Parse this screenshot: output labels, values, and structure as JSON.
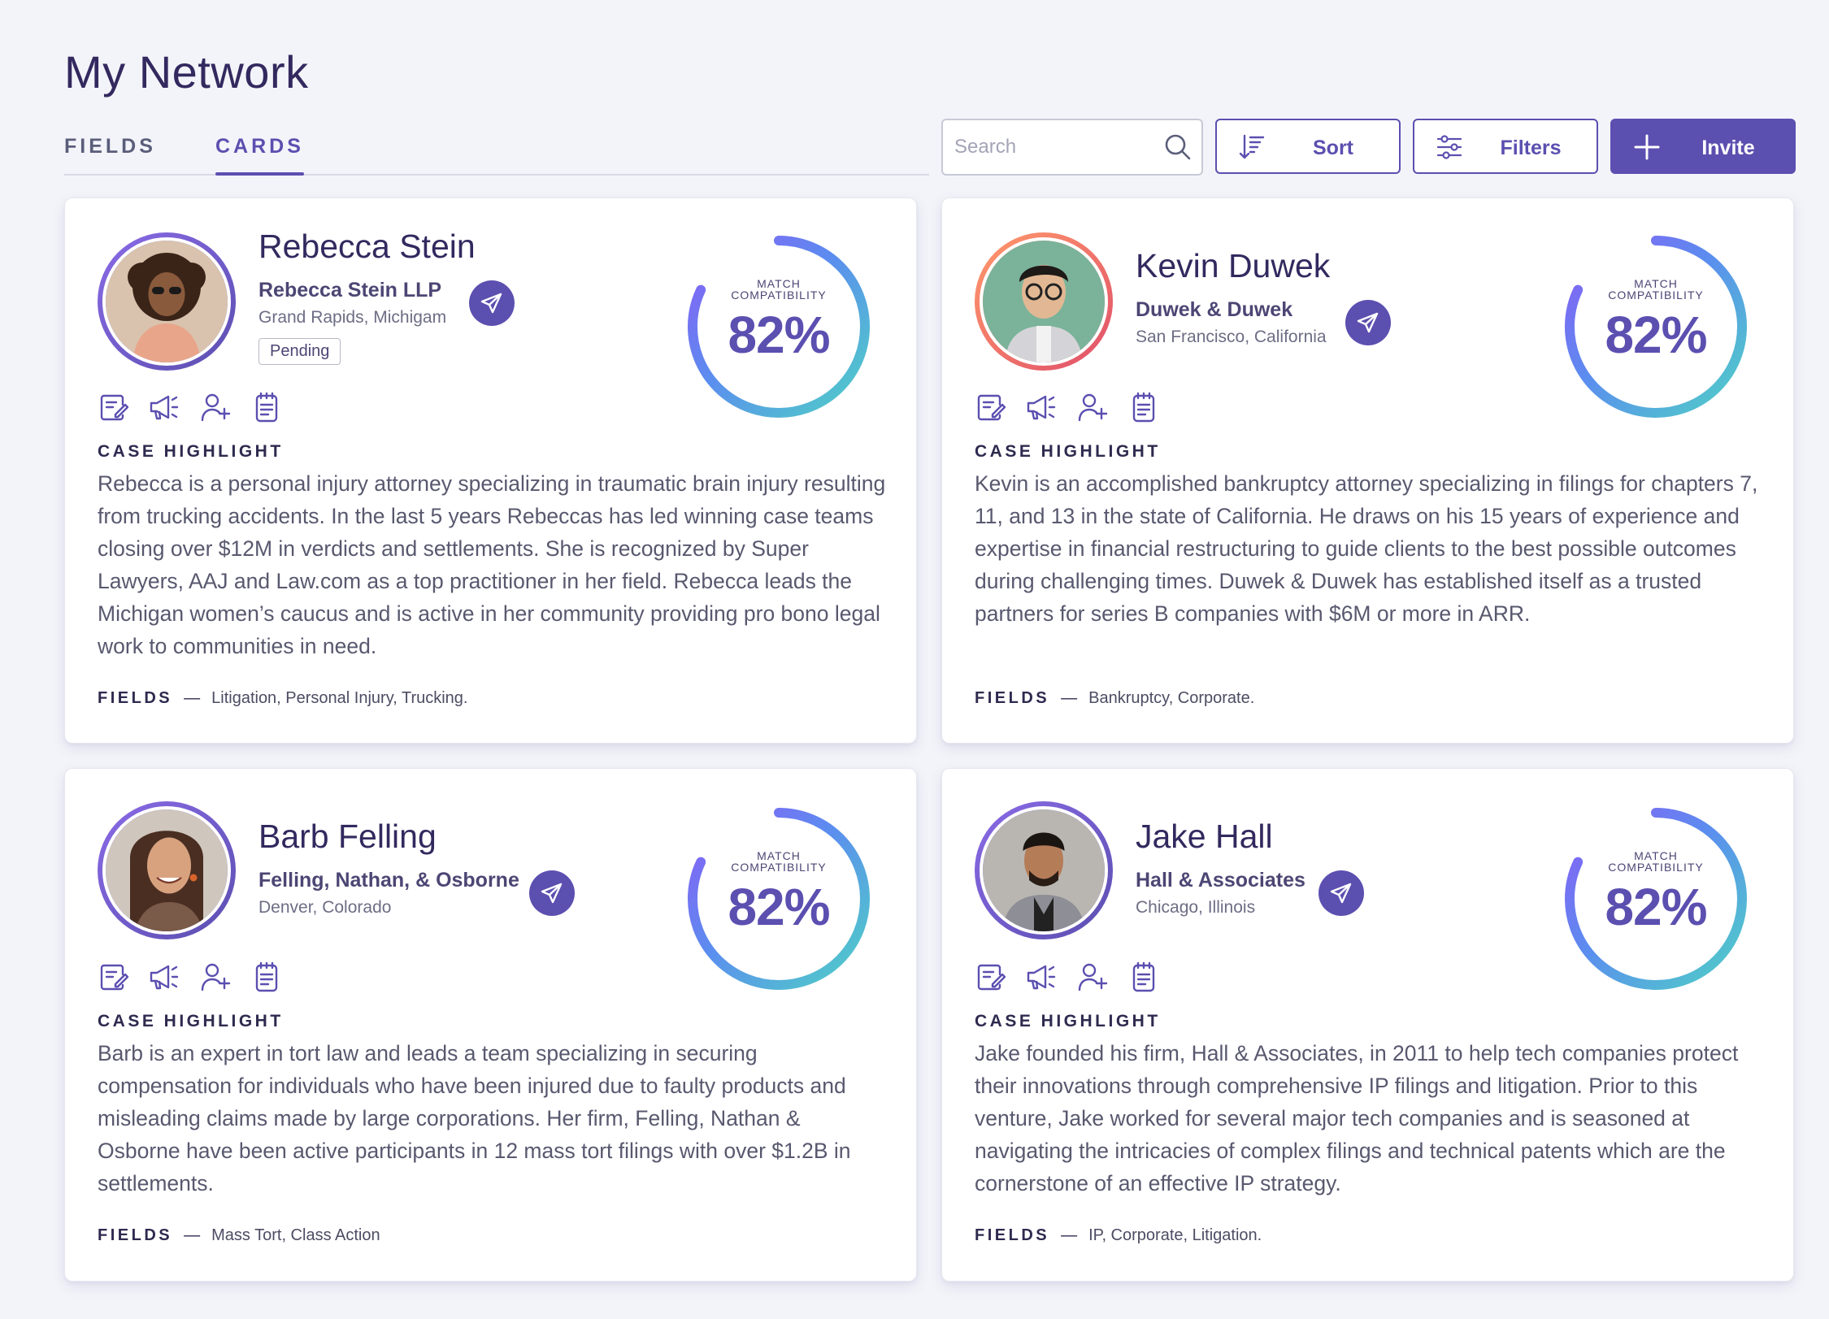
{
  "page": {
    "title": "My Network"
  },
  "tabs": [
    {
      "label": "FIELDS",
      "active": false
    },
    {
      "label": "CARDS",
      "active": true
    }
  ],
  "toolbar": {
    "search_placeholder": "Search",
    "sort_label": "Sort",
    "filters_label": "Filters",
    "invite_label": "Invite"
  },
  "colors": {
    "accent": "#5b4fb0",
    "gauge_start": "#4fd1c5",
    "gauge_end": "#8b5cf6"
  },
  "cards": [
    {
      "name": "Rebecca Stein",
      "firm": "Rebecca Stein LLP",
      "location": "Grand Rapids, Michigam",
      "status": "Pending",
      "compat_label_1": "MATCH",
      "compat_label_2": "COMPATIBILITY",
      "compatibility": "82%",
      "compat_value": 82,
      "highlight_title": "CASE HIGHLIGHT",
      "highlight": "Rebecca is a personal injury attorney specializing in traumatic brain injury resulting from trucking accidents. In the last 5 years Rebeccas has led winning case teams closing over $12M in verdicts and settlements. She is recognized by Super Lawyers, AAJ and Law.com as a top practitioner in her field. Rebecca leads the Michigan women’s caucus and is active in her community providing pro bono legal work to communities in need.",
      "fields_label": "FIELDS",
      "fields": "Litigation, Personal Injury, Trucking."
    },
    {
      "name": "Kevin Duwek",
      "firm": "Duwek & Duwek",
      "location": "San Francisco, California",
      "compat_label_1": "MATCH",
      "compat_label_2": "COMPATIBILITY",
      "compatibility": "82%",
      "compat_value": 82,
      "highlight_title": "CASE HIGHLIGHT",
      "highlight": "Kevin is an accomplished bankruptcy attorney specializing in filings for chapters 7, 11, and 13 in the state of California. He draws on his 15 years of experience and expertise in financial restructuring to guide clients to the best possible outcomes during challenging times.  Duwek & Duwek has established itself as a trusted partners for series B companies with $6M or more in ARR.",
      "fields_label": "FIELDS",
      "fields": "Bankruptcy, Corporate."
    },
    {
      "name": "Barb Felling",
      "firm": "Felling, Nathan, & Osborne",
      "location": "Denver, Colorado",
      "compat_label_1": "MATCH",
      "compat_label_2": "COMPATIBILITY",
      "compatibility": "82%",
      "compat_value": 82,
      "highlight_title": "CASE HIGHLIGHT",
      "highlight": "Barb is an expert in tort law and leads a team specializing in securing compensation for individuals who have been injured due to faulty products and misleading claims made by large corporations.  Her firm, Felling, Nathan & Osborne have been active participants in 12 mass tort filings with over $1.2B in settlements.",
      "fields_label": "FIELDS",
      "fields": "Mass Tort, Class Action"
    },
    {
      "name": "Jake Hall",
      "firm": "Hall & Associates",
      "location": "Chicago, Illinois",
      "compat_label_1": "MATCH",
      "compat_label_2": "COMPATIBILITY",
      "compatibility": "82%",
      "compat_value": 82,
      "highlight_title": "CASE HIGHLIGHT",
      "highlight": "Jake founded his firm, Hall & Associates, in 2011 to help tech companies protect their innovations through comprehensive IP filings and litigation. Prior to this venture, Jake worked for several major tech companies and is seasoned at navigating the intricacies of complex filings and technical patents which are the cornerstone of an effective IP strategy.",
      "fields_label": "FIELDS",
      "fields": "IP, Corporate, Litigation."
    }
  ]
}
